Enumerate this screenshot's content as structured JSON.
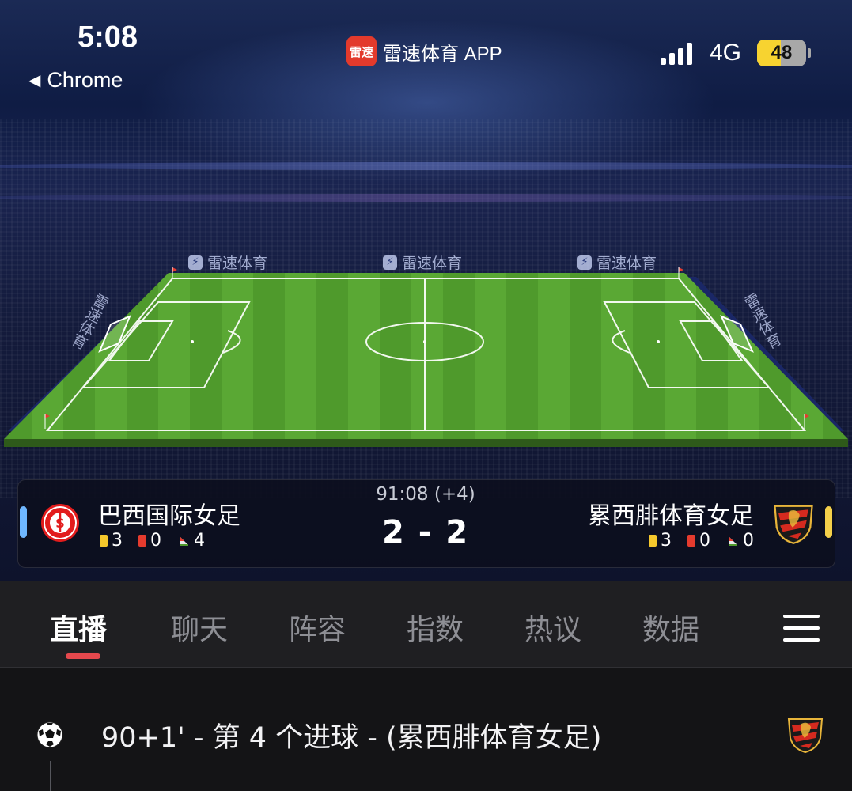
{
  "status_bar": {
    "time": "5:08",
    "back_label": "Chrome",
    "app_name": "雷速体育 APP",
    "app_icon_text": "雷速",
    "network": "4G",
    "battery_percent": 48,
    "battery_text": "48"
  },
  "stadium": {
    "ad_boards": [
      "雷速体育",
      "雷速体育",
      "雷速体育",
      "雷速体育",
      "雷速体育"
    ]
  },
  "match": {
    "home": {
      "name": "巴西国际女足",
      "yellow_cards": "3",
      "red_cards": "0",
      "corners": "4",
      "indicator_color": "#6fb7ff"
    },
    "away": {
      "name": "累西腓体育女足",
      "yellow_cards": "3",
      "red_cards": "0",
      "corners": "0",
      "indicator_color": "#f4d04a"
    },
    "clock": "91:08 (+4)",
    "score": "2 - 2"
  },
  "tabs": {
    "items": [
      {
        "label": "直播",
        "active": true
      },
      {
        "label": "聊天"
      },
      {
        "label": "阵容"
      },
      {
        "label": "指数"
      },
      {
        "label": "热议"
      },
      {
        "label": "数据"
      }
    ],
    "menu_icon": "hamburger-menu-icon",
    "active_color": "#e5484d"
  },
  "events": [
    {
      "icon": "soccer-ball-icon",
      "text": "90+1' - 第 4 个进球 - (累西腓体育女足)",
      "team_crest": "away"
    }
  ]
}
